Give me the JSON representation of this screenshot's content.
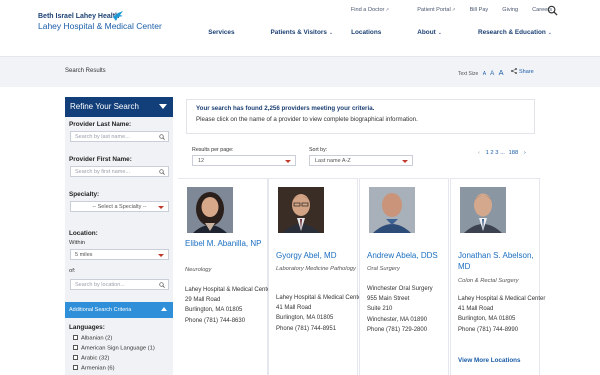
{
  "header": {
    "logo_top": "Beth Israel Lahey Health",
    "logo_bottom": "Lahey Hospital & Medical Center",
    "utility": [
      {
        "label": "Find a Doctor"
      },
      {
        "label": "Patient Portal"
      },
      {
        "label": "Bill Pay"
      },
      {
        "label": "Giving"
      },
      {
        "label": "Careers"
      }
    ],
    "nav": [
      {
        "label": "Services"
      },
      {
        "label": "Patients & Visitors"
      },
      {
        "label": "Locations"
      },
      {
        "label": "About"
      },
      {
        "label": "Research & Education"
      }
    ]
  },
  "subbar": {
    "title": "Search Results",
    "text_size_label": "Text Size",
    "text_size_letters": [
      "A",
      "A",
      "A"
    ],
    "share": "Share"
  },
  "sidebar": {
    "heading": "Refine Your Search",
    "last_name_label": "Provider Last Name:",
    "last_name_placeholder": "Search by last name...",
    "first_name_label": "Provider First Name:",
    "first_name_placeholder": "Search by first name...",
    "specialty_label": "Specialty:",
    "specialty_value": "-- Select a Specialty --",
    "location_label": "Location:",
    "within_label": "Within",
    "within_value": "5 miles",
    "of_label": "of:",
    "location_placeholder": "Search by location...",
    "advanced_label": "Additional Search Criteria",
    "languages_label": "Languages:",
    "languages": [
      "Albanian (2)",
      "American Sign Language (1)",
      "Arabic (32)",
      "Armenian (6)"
    ]
  },
  "results": {
    "notice_line1": "Your search has found 2,256 providers meeting your criteria.",
    "notice_line2": "Please click on the name of a provider to view complete biographical information.",
    "per_page_label": "Results per page:",
    "per_page_value": "12",
    "sort_label": "Sort by:",
    "sort_value": "Last name A-Z",
    "pager": {
      "prev": "‹",
      "pages": "1 2 3 ...",
      "last": "188",
      "next": "›"
    }
  },
  "doctors": [
    {
      "name": "Elibel M. Abanilla, NP",
      "specialty": "Neurology",
      "practice": "Lahey Hospital & Medical Center",
      "street": "29 Mall Road",
      "city": "Burlington, MA  01805",
      "phone": "Phone (781) 744-8630"
    },
    {
      "name": "Gyorgy Abel, MD",
      "specialty": "Laboratory Medicine Pathology",
      "practice": "Lahey Hospital & Medical Center",
      "street": "41 Mall Road",
      "city": "Burlington, MA  01805",
      "phone": "Phone (781) 744-8951"
    },
    {
      "name": "Andrew Abela, DDS",
      "specialty": "Oral Surgery",
      "practice": "Winchester Oral Surgery",
      "street": "955 Main Street",
      "street2": "Suite 210",
      "city": "Winchester, MA  01890",
      "phone": "Phone (781) 729-2800"
    },
    {
      "name": "Jonathan S. Abelson, MD",
      "specialty": "Colon & Rectal Surgery",
      "practice": "Lahey Hospital & Medical Center",
      "street": "41 Mall Road",
      "city": "Burlington, MA  01805",
      "phone": "Phone (781) 744-8990",
      "view_more": "View More Locations"
    }
  ],
  "colors": {
    "navy": "#123f7a",
    "link_blue": "#1b6fc0",
    "accent_blue": "#2f8fd8",
    "red_caret": "#c0392b"
  }
}
